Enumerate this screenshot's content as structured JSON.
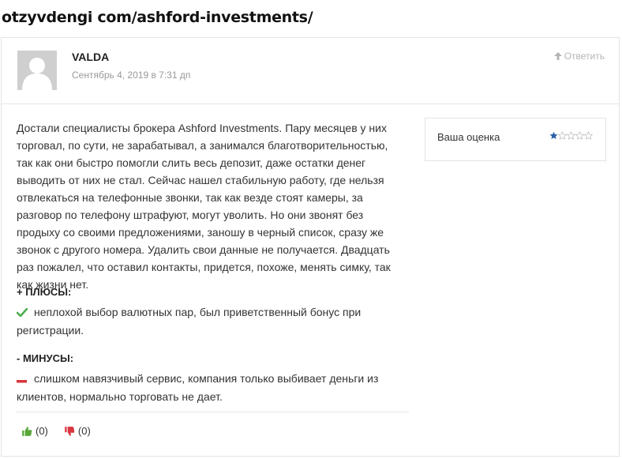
{
  "site": {
    "url": "otzyvdengi com/ashford-investments/"
  },
  "comment": {
    "author": "VALDA",
    "date": "Сентябрь 4, 2019 в 7:31 дп",
    "reply_label": "Ответить",
    "text": "Достали специалисты брокера Ashford Investments. Пару месяцев у них торговал, по сути, не зарабатывал, а занимался благотворительностью, так как они быстро помогли слить весь депозит, даже остатки денег выводить от них не стал. Сейчас нашел стабильную работу, где нельзя отвлекаться на телефонные звонки, так как везде стоят камеры, за разговор по телефону штрафуют, могут уволить. Но они звонят без продыху со своими предложениями, заношу в черный список, сразу же звонок с другого номера. Удалить свои данные не получается. Двадцать раз пожалел, что оставил контакты, придется, похоже, менять симку, так как жизни нет.",
    "pros_title": "+ ПЛЮСЫ:",
    "pros_text": "неплохой выбор валютных пар, был приветственный бонус при регистрации.",
    "cons_title": "- МИНУСЫ:",
    "cons_text": "слишком навязчивый сервис, компания только выбивает деньги из клиентов, нормально торговать не дает.",
    "rating": {
      "label": "Ваша оценка",
      "value": 1,
      "max": 5,
      "star_color": "#2b5fa8"
    },
    "likes": "(0)",
    "dislikes": "(0)"
  },
  "colors": {
    "like_green": "#5aa83a",
    "dislike_red": "#d9363e",
    "check_green": "#4caf50",
    "minus_red": "#d9363e"
  }
}
